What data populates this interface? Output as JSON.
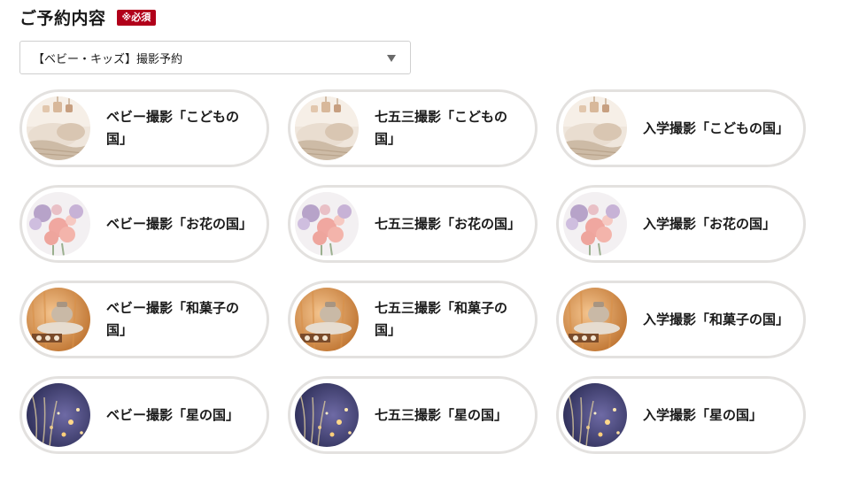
{
  "header": {
    "title": "ご予約内容",
    "required_badge": "※必須"
  },
  "plan_select": {
    "selected": "【ベビー・キッズ】撮影予約"
  },
  "cards": [
    {
      "label": "ベビー撮影「こどもの国」",
      "theme": "kodomo"
    },
    {
      "label": "七五三撮影「こどもの国」",
      "theme": "kodomo"
    },
    {
      "label": "入学撮影「こどもの国」",
      "theme": "kodomo"
    },
    {
      "label": "ベビー撮影「お花の国」",
      "theme": "ohana"
    },
    {
      "label": "七五三撮影「お花の国」",
      "theme": "ohana"
    },
    {
      "label": "入学撮影「お花の国」",
      "theme": "ohana"
    },
    {
      "label": "ベビー撮影「和菓子の国」",
      "theme": "wagashi"
    },
    {
      "label": "七五三撮影「和菓子の国」",
      "theme": "wagashi"
    },
    {
      "label": "入学撮影「和菓子の国」",
      "theme": "wagashi"
    },
    {
      "label": "ベビー撮影「星の国」",
      "theme": "hoshi"
    },
    {
      "label": "七五三撮影「星の国」",
      "theme": "hoshi"
    },
    {
      "label": "入学撮影「星の国」",
      "theme": "hoshi"
    }
  ],
  "colors": {
    "badge_bg": "#b1001a",
    "card_border": "#e3e1df"
  }
}
